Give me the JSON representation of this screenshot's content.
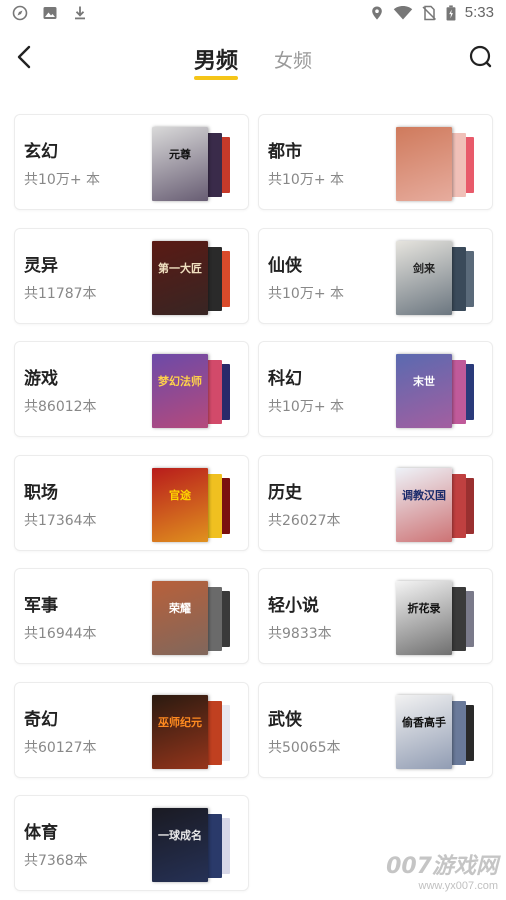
{
  "status_bar": {
    "time": "5:33",
    "left_icons": [
      "compass-icon",
      "image-icon",
      "download-icon"
    ],
    "right_icons": [
      "location-icon",
      "wifi-icon",
      "no-sim-icon",
      "battery-icon"
    ]
  },
  "header": {
    "tabs": [
      {
        "label": "男频",
        "active": true
      },
      {
        "label": "女频",
        "active": false
      }
    ],
    "accent_color": "#f5c518"
  },
  "categories": [
    {
      "name": "玄幻",
      "count": "共10万+ 本",
      "cover": {
        "text": "元尊",
        "bg": "#d9d9d9",
        "fg": "#111",
        "b2": "#3a2b4a",
        "b3": "#c63a2a"
      }
    },
    {
      "name": "都市",
      "count": "共10万+ 本",
      "cover": {
        "text": "",
        "bg": "#cf7a5c",
        "fg": "#fff",
        "b2": "#f0c0b8",
        "b3": "#e85a6a"
      }
    },
    {
      "name": "灵异",
      "count": "共11787本",
      "cover": {
        "text": "第一大匠",
        "bg": "#5a1a14",
        "fg": "#f0e0c0",
        "b2": "#2a2a2a",
        "b3": "#d94b2b"
      }
    },
    {
      "name": "仙侠",
      "count": "共10万+ 本",
      "cover": {
        "text": "剑来",
        "bg": "#e6e4de",
        "fg": "#222",
        "b2": "#3a4a5a",
        "b3": "#5a6a7a"
      }
    },
    {
      "name": "游戏",
      "count": "共86012本",
      "cover": {
        "text": "梦幻法师",
        "bg": "#6c4aa8",
        "fg": "#ffd24a",
        "b2": "#d24a6a",
        "b3": "#2a2a6a"
      }
    },
    {
      "name": "科幻",
      "count": "共10万+ 本",
      "cover": {
        "text": "末世",
        "bg": "#5a6ab0",
        "fg": "#fff",
        "b2": "#c05a9a",
        "b3": "#2a3a7a"
      }
    },
    {
      "name": "职场",
      "count": "共17364本",
      "cover": {
        "text": "官途",
        "bg": "#b81c1c",
        "fg": "#ffd400",
        "b2": "#f0c020",
        "b3": "#7a1010"
      }
    },
    {
      "name": "历史",
      "count": "共26027本",
      "cover": {
        "text": "调教汉国",
        "bg": "#eef2f8",
        "fg": "#1a2a6a",
        "b2": "#c04040",
        "b3": "#9a3030"
      }
    },
    {
      "name": "军事",
      "count": "共16944本",
      "cover": {
        "text": "荣耀",
        "bg": "#b8603a",
        "fg": "#fff",
        "b2": "#6a6a6a",
        "b3": "#3a3a3a"
      }
    },
    {
      "name": "轻小说",
      "count": "共9833本",
      "cover": {
        "text": "折花录",
        "bg": "#f4f4f4",
        "fg": "#111",
        "b2": "#3a3a3a",
        "b3": "#7a7a8a"
      }
    },
    {
      "name": "奇幻",
      "count": "共60127本",
      "cover": {
        "text": "巫师纪元",
        "bg": "#2a1a10",
        "fg": "#ff8a20",
        "b2": "#c04020",
        "b3": "#e8e8f0"
      }
    },
    {
      "name": "武侠",
      "count": "共50065本",
      "cover": {
        "text": "偷香高手",
        "bg": "#f2f2f2",
        "fg": "#111",
        "b2": "#6a7a9a",
        "b3": "#2a2a2a"
      }
    },
    {
      "name": "体育",
      "count": "共7368本",
      "cover": {
        "text": "一球成名",
        "bg": "#1a1a22",
        "fg": "#e8e8e8",
        "b2": "#2a3a6a",
        "b3": "#d8d8e8"
      }
    }
  ],
  "watermark": {
    "main": "007游戏网",
    "sub": "www.yx007.com"
  }
}
